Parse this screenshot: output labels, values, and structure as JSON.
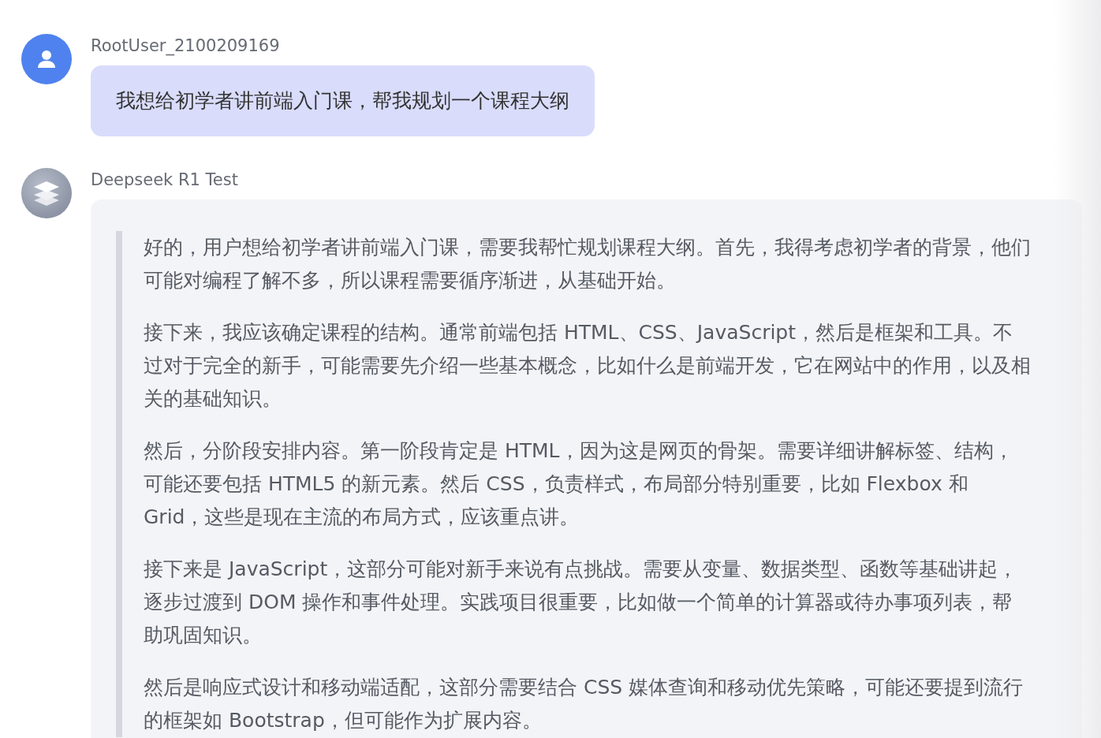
{
  "messages": [
    {
      "kind": "user",
      "author": "RootUser_2100209169",
      "text": "我想给初学者讲前端入门课，帮我规划一个课程大纲"
    },
    {
      "kind": "assistant",
      "author": "Deepseek R1 Test",
      "paragraphs": [
        "好的，用户想给初学者讲前端入门课，需要我帮忙规划课程大纲。首先，我得考虑初学者的背景，他们可能对编程了解不多，所以课程需要循序渐进，从基础开始。",
        "接下来，我应该确定课程的结构。通常前端包括 HTML、CSS、JavaScript，然后是框架和工具。不过对于完全的新手，可能需要先介绍一些基本概念，比如什么是前端开发，它在网站中的作用，以及相关的基础知识。",
        "然后，分阶段安排内容。第一阶段肯定是 HTML，因为这是网页的骨架。需要详细讲解标签、结构，可能还要包括 HTML5 的新元素。然后 CSS，负责样式，布局部分特别重要，比如 Flexbox 和 Grid，这些是现在主流的布局方式，应该重点讲。",
        "接下来是 JavaScript，这部分可能对新手来说有点挑战。需要从变量、数据类型、函数等基础讲起，逐步过渡到 DOM 操作和事件处理。实践项目很重要，比如做一个简单的计算器或待办事项列表，帮助巩固知识。",
        "然后是响应式设计和移动端适配，这部分需要结合 CSS 媒体查询和移动优先策略，可能还要提到流行的框架如 Bootstrap，但可能作为扩展内容。"
      ]
    }
  ]
}
